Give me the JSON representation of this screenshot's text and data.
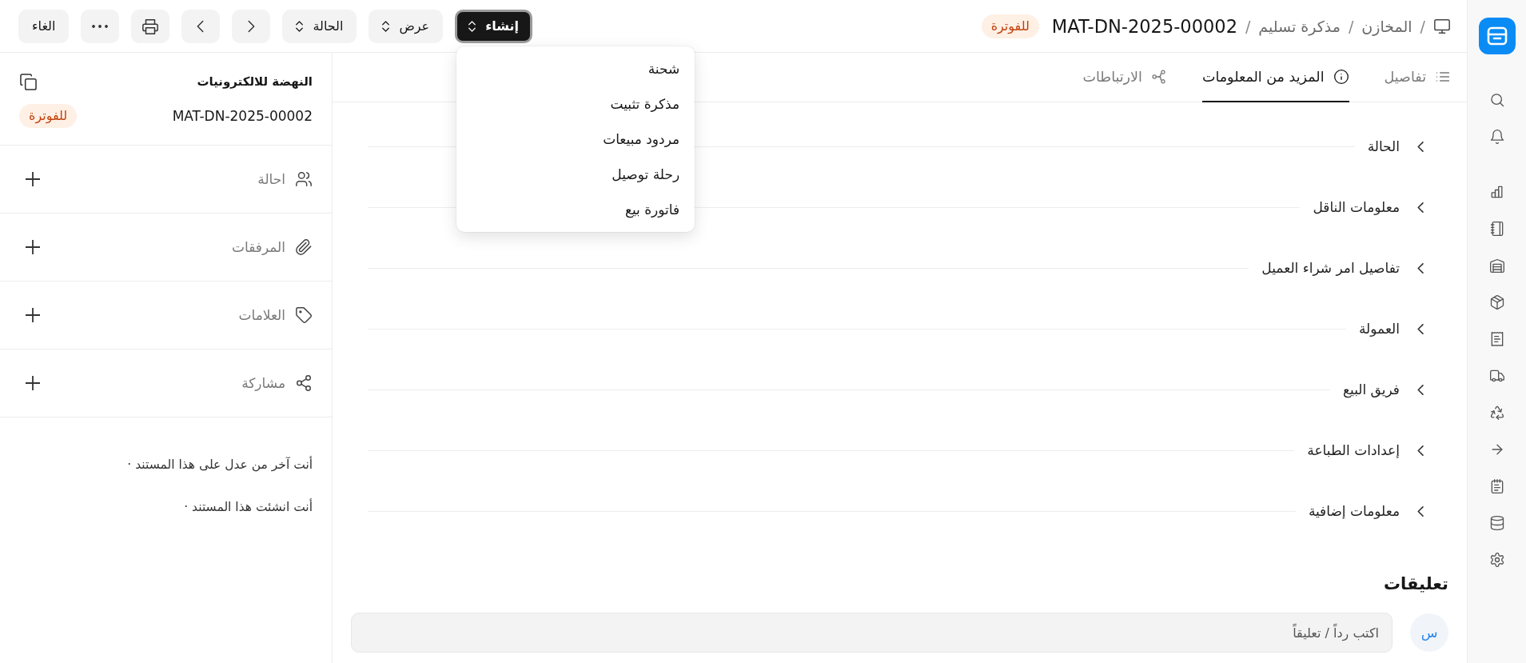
{
  "breadcrumb": {
    "items": [
      "المخازن",
      "مذكرة تسليم"
    ],
    "separator": "/",
    "current": "MAT-DN-2025-00002",
    "status": "للفوترة"
  },
  "toolbar": {
    "buttons": [
      {
        "kind": "primary",
        "label": "إنشاء",
        "expanded": true,
        "menu": [
          "شحنة",
          "مذكرة تثبيت",
          "مردود مبيعات",
          "رحلة توصيل",
          "فاتورة بيع"
        ]
      },
      {
        "kind": "dropdown",
        "label": "عرض",
        "expanded": false
      },
      {
        "kind": "dropdown",
        "label": "الحالة",
        "expanded": false
      },
      {
        "kind": "previous"
      },
      {
        "kind": "next"
      },
      {
        "kind": "print"
      },
      {
        "kind": "more"
      },
      {
        "kind": "cancel",
        "label": "الغاء"
      }
    ]
  },
  "tabs": [
    {
      "kind": "list",
      "label": "تفاصيل",
      "selected": false
    },
    {
      "kind": "info",
      "label": "المزيد من المعلومات",
      "selected": true
    },
    {
      "kind": "connections",
      "label": "الارتباطات",
      "selected": false
    }
  ],
  "sections": [
    {
      "label": "الحالة",
      "expanded": false
    },
    {
      "label": "معلومات الناقل",
      "expanded": false
    },
    {
      "label": "تفاصيل امر شراء العميل",
      "expanded": false
    },
    {
      "label": "العمولة",
      "expanded": false
    },
    {
      "label": "فريق البيع",
      "expanded": false
    },
    {
      "label": "إعدادات الطباعة",
      "expanded": false
    },
    {
      "label": "معلومات إضافية",
      "expanded": false
    }
  ],
  "comments": {
    "title": "تعليقات",
    "avatar": "س",
    "placeholder": "اكتب رداً / تعليقاً"
  },
  "document_panel": {
    "title": "النهضة للالكترونيات",
    "name": "MAT-DN-2025-00002",
    "status": "للفوترة",
    "actions": [
      {
        "kind": "assign",
        "label": "احالة"
      },
      {
        "kind": "attachments",
        "label": "المرفقات"
      },
      {
        "kind": "tags",
        "label": "العلامات"
      },
      {
        "kind": "share",
        "label": "مشاركة"
      }
    ],
    "activity": [
      "أنت آخر من عدل على هذا المستند ·",
      "أنت انشئت هذا المستند ·"
    ]
  }
}
